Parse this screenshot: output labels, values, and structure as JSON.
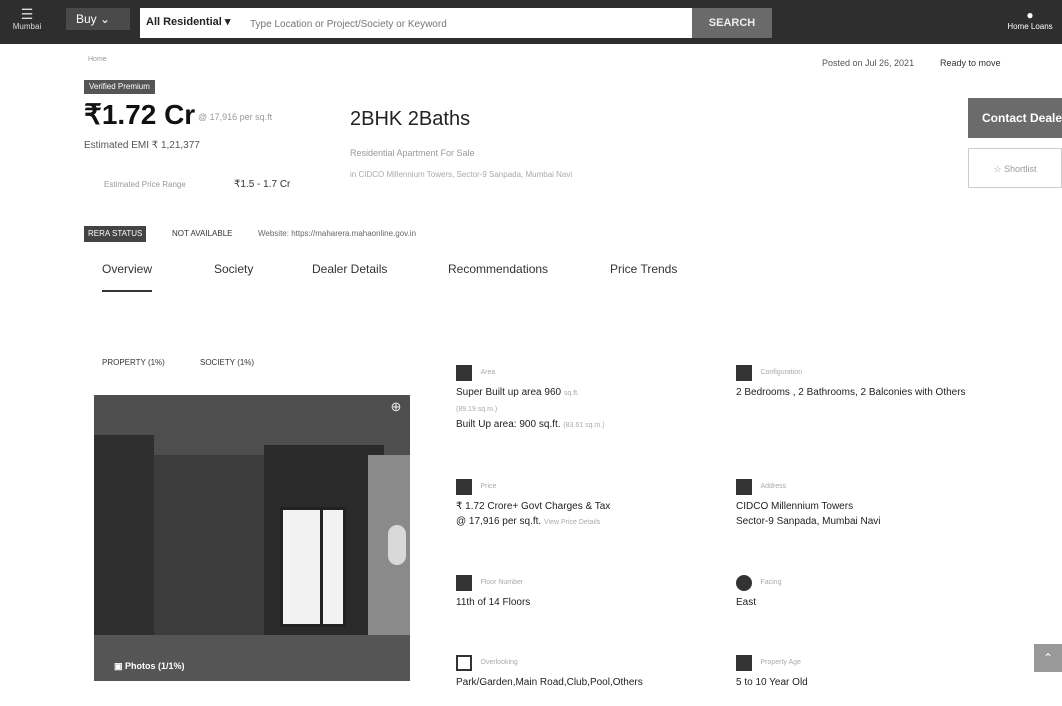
{
  "header": {
    "logo_text": "Mumbai",
    "buy_label": "Buy",
    "property_type": "All Residential",
    "search_placeholder": "Type Location or Project/Society or Keyword",
    "search_button": "SEARCH",
    "home_loans": "Home Loans"
  },
  "meta": {
    "breadcrumb": "Home",
    "posted_on": "Posted on Jul 26, 2021",
    "status": "Ready to move"
  },
  "summary": {
    "badge": "Verified  Premium",
    "price": "₹1.72 Cr",
    "price_per_sqft": "@ 17,916 per sq.ft",
    "emi": "Estimated EMI ₹ 1,21,377",
    "estimated_label": "Estimated Price Range",
    "estimated_range": "₹1.5 - 1.7 Cr",
    "title": "2BHK 2Baths",
    "subtitle": "Residential Apartment For Sale",
    "address": "in CIDCO Millennium Towers, Sector-9 Sanpada, Mumbai Navi"
  },
  "actions": {
    "contact": "Contact Dealer",
    "shortlist": "Shortlist"
  },
  "rera": {
    "badge": "RERA STATUS",
    "value": "NOT AVAILABLE",
    "website": "Website: https://maharera.mahaonline.gov.in"
  },
  "tabs": [
    "Overview",
    "Society",
    "Dealer Details",
    "Recommendations",
    "Price Trends"
  ],
  "photo_tabs": {
    "property": "PROPERTY (1%)",
    "society": "SOCIETY (1%)"
  },
  "photo": {
    "count": "Photos (1/1%)"
  },
  "details": {
    "area_label": "Area",
    "super_area": "Super Built up area 960",
    "super_area_unit": "sq.ft.",
    "super_area_sqm": "(89.19 sq.m.)",
    "built_area": "Built Up area: 900 sq.ft.",
    "built_area_sqm": "(83.61 sq.m.)",
    "config_label": "Configuration",
    "config": "2 Bedrooms , 2 Bathrooms, 2 Balconies with Others",
    "price_label": "Price",
    "price": "₹ 1.72 Crore+ Govt Charges & Tax",
    "price_psf": "@ 17,916 per sq.ft.",
    "price_link": "View Price Details",
    "address_label": "Address",
    "address_1": "CIDCO Millennium Towers",
    "address_2": "Sector-9 Sanpada, Mumbai Navi",
    "floor_label": "Floor Number",
    "floor": "11th  of 14 Floors",
    "facing_label": "Facing",
    "facing": "East",
    "overlooking_label": "Overlooking",
    "overlooking": "Park/Garden,Main Road,Club,Pool,Others",
    "age_label": "Property Age",
    "age": "5 to 10 Year Old"
  },
  "colors": {
    "topbar": "#2e2e2e",
    "button_dark": "#6b6b6b"
  }
}
